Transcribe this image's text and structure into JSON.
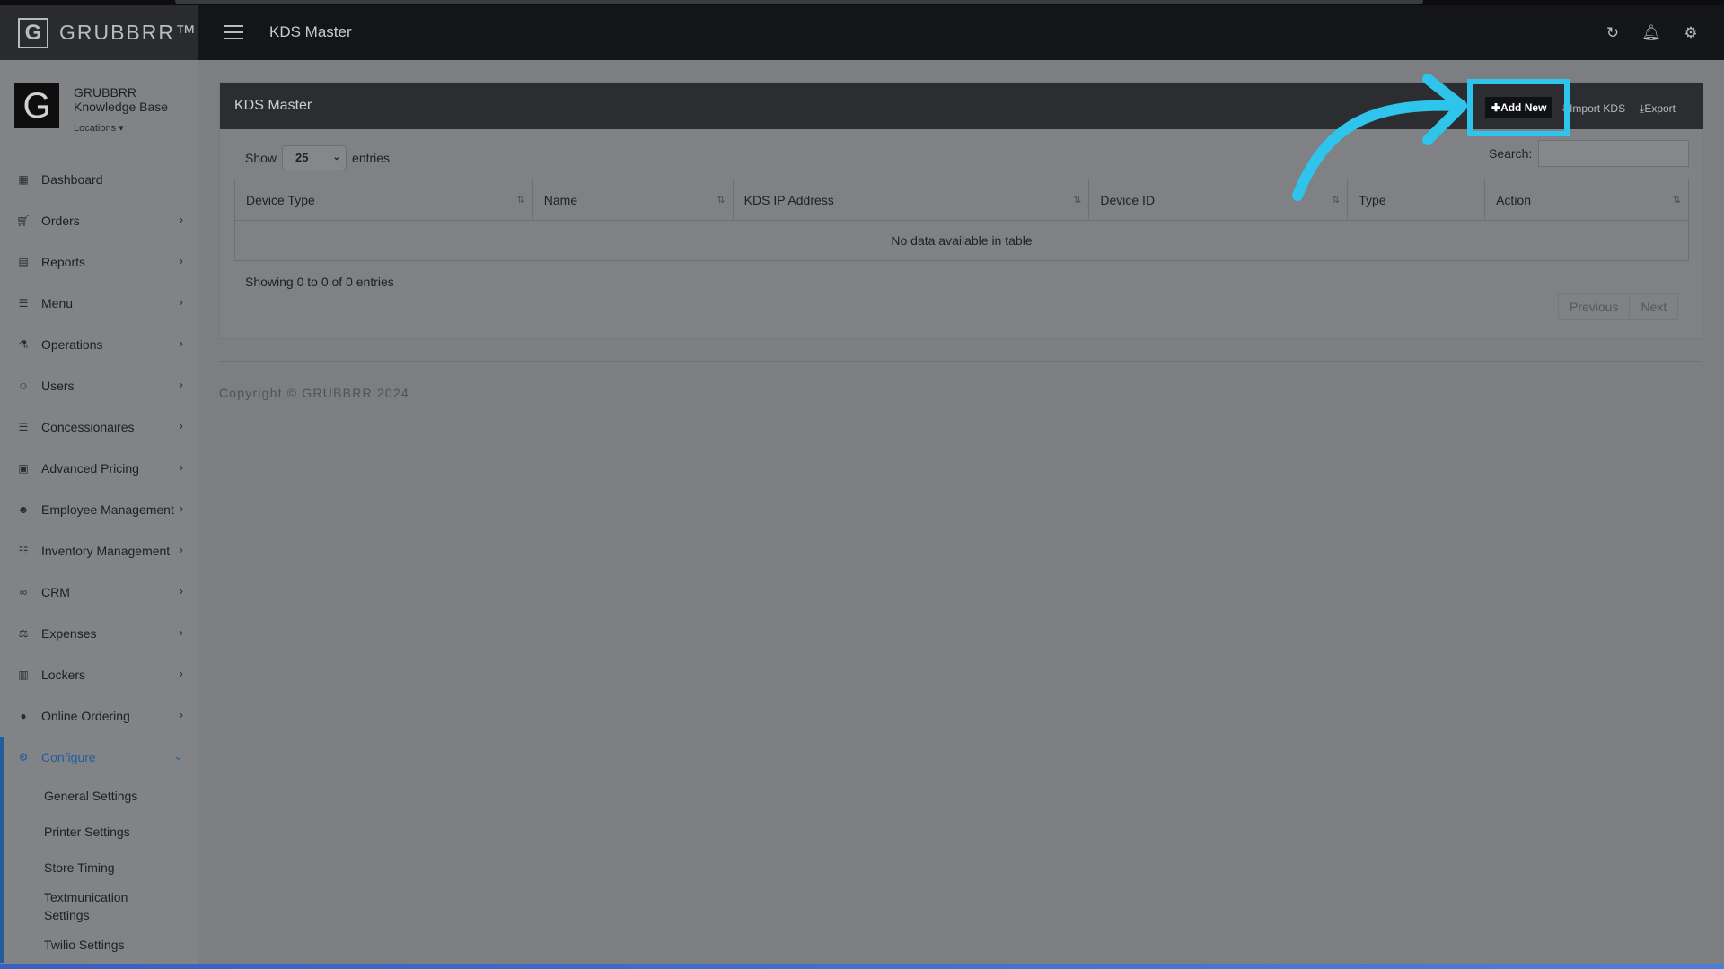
{
  "header": {
    "brand": "GRUBBRR™",
    "brand_letter": "G",
    "title": "KDS Master",
    "icons": [
      "refresh-icon",
      "bell-icon",
      "gear-icon"
    ]
  },
  "sidebar": {
    "org_name": "GRUBBRR Knowledge Base",
    "avatar_letter": "G",
    "locations_label": "Locations",
    "items": [
      {
        "label": "Dashboard",
        "icon": "dashboard-icon",
        "has_children": false
      },
      {
        "label": "Orders",
        "icon": "cart-icon",
        "has_children": true
      },
      {
        "label": "Reports",
        "icon": "report-icon",
        "has_children": true
      },
      {
        "label": "Menu",
        "icon": "list-icon",
        "has_children": true
      },
      {
        "label": "Operations",
        "icon": "flask-icon",
        "has_children": true
      },
      {
        "label": "Users",
        "icon": "user-plus-icon",
        "has_children": true
      },
      {
        "label": "Concessionaires",
        "icon": "list-icon",
        "has_children": true
      },
      {
        "label": "Advanced Pricing",
        "icon": "money-icon",
        "has_children": true
      },
      {
        "label": "Employee Management",
        "icon": "users-icon",
        "has_children": true
      },
      {
        "label": "Inventory Management",
        "icon": "sitemap-icon",
        "has_children": true
      },
      {
        "label": "CRM",
        "icon": "link-icon",
        "has_children": true
      },
      {
        "label": "Expenses",
        "icon": "balance-icon",
        "has_children": true
      },
      {
        "label": "Lockers",
        "icon": "locker-icon",
        "has_children": true
      },
      {
        "label": "Online Ordering",
        "icon": "globe-icon",
        "has_children": true
      },
      {
        "label": "Configure",
        "icon": "cog-icon",
        "has_children": true,
        "active": true
      }
    ],
    "configure_children": [
      "General Settings",
      "Printer Settings",
      "Store Timing",
      "Textmunication Settings",
      "Twilio Settings"
    ]
  },
  "panel": {
    "title": "KDS Master",
    "add_new": "Add New",
    "import": "Import KDS",
    "export": "Export",
    "show_label": "Show",
    "entries_value": "25",
    "entries_label": "entries",
    "search_label": "Search:",
    "search_value": "",
    "columns": [
      "Device Type",
      "Name",
      "KDS IP Address",
      "Device ID",
      "Type",
      "Action"
    ],
    "empty_message": "No data available in table",
    "info": "Showing 0 to 0 of 0 entries",
    "previous": "Previous",
    "next": "Next"
  },
  "footer": {
    "copyright": "Copyright © GRUBBRR 2024"
  },
  "colors": {
    "accent": "#2ec4ec",
    "active_nav": "#1f5e9a",
    "header_bg": "#141517"
  }
}
